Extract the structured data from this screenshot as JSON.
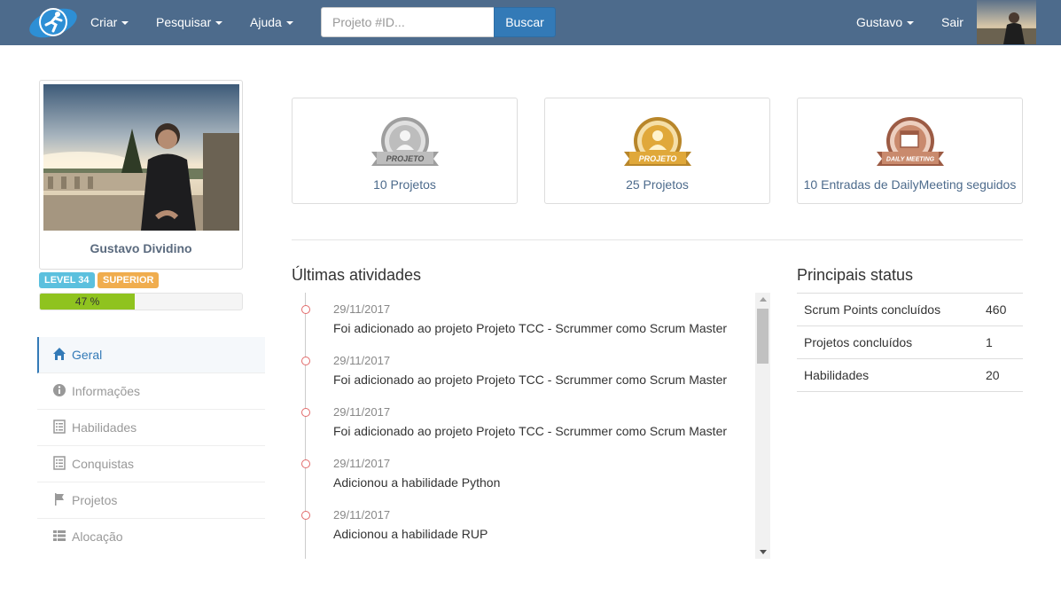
{
  "nav": {
    "menu": [
      {
        "label": "Criar"
      },
      {
        "label": "Pesquisar"
      },
      {
        "label": "Ajuda"
      }
    ],
    "search_placeholder": "Projeto #ID...",
    "search_button": "Buscar",
    "user_label": "Gustavo",
    "logout_label": "Sair"
  },
  "profile": {
    "name": "Gustavo Dividino",
    "level_badge": "LEVEL 34",
    "rank_badge": "SUPERIOR",
    "progress_percent": 47,
    "progress_label": "47 %"
  },
  "sidebar": {
    "items": [
      {
        "label": "Geral",
        "icon": "home-icon",
        "active": true
      },
      {
        "label": "Informações",
        "icon": "info-icon"
      },
      {
        "label": "Habilidades",
        "icon": "list-icon"
      },
      {
        "label": "Conquistas",
        "icon": "list-icon"
      },
      {
        "label": "Projetos",
        "icon": "flag-icon"
      },
      {
        "label": "Alocação",
        "icon": "table-icon"
      }
    ]
  },
  "achievements": [
    {
      "badge_text": "PROJETO",
      "label": "10 Projetos",
      "tier": "silver"
    },
    {
      "badge_text": "PROJETO",
      "label": "25 Projetos",
      "tier": "gold"
    },
    {
      "badge_text": "DAILY MEETING",
      "label": "10 Entradas de DailyMeeting seguidos",
      "tier": "bronze"
    }
  ],
  "activities": {
    "title": "Últimas atividades",
    "items": [
      {
        "date": "29/11/2017",
        "text": "Foi adicionado ao projeto Projeto TCC - Scrummer como Scrum Master"
      },
      {
        "date": "29/11/2017",
        "text": "Foi adicionado ao projeto Projeto TCC - Scrummer como Scrum Master"
      },
      {
        "date": "29/11/2017",
        "text": "Foi adicionado ao projeto Projeto TCC - Scrummer como Scrum Master"
      },
      {
        "date": "29/11/2017",
        "text": "Adicionou a habilidade Python"
      },
      {
        "date": "29/11/2017",
        "text": "Adicionou a habilidade RUP"
      }
    ]
  },
  "status": {
    "title": "Principais status",
    "rows": [
      {
        "label": "Scrum Points concluídos",
        "value": "460"
      },
      {
        "label": "Projetos concluídos",
        "value": "1"
      },
      {
        "label": "Habilidades",
        "value": "20"
      }
    ]
  },
  "colors": {
    "navbar": "#4d6b8c",
    "primary": "#337ab7",
    "badge_info": "#5bc0de",
    "badge_warning": "#f0ad4e",
    "progress": "#8fc31f"
  }
}
